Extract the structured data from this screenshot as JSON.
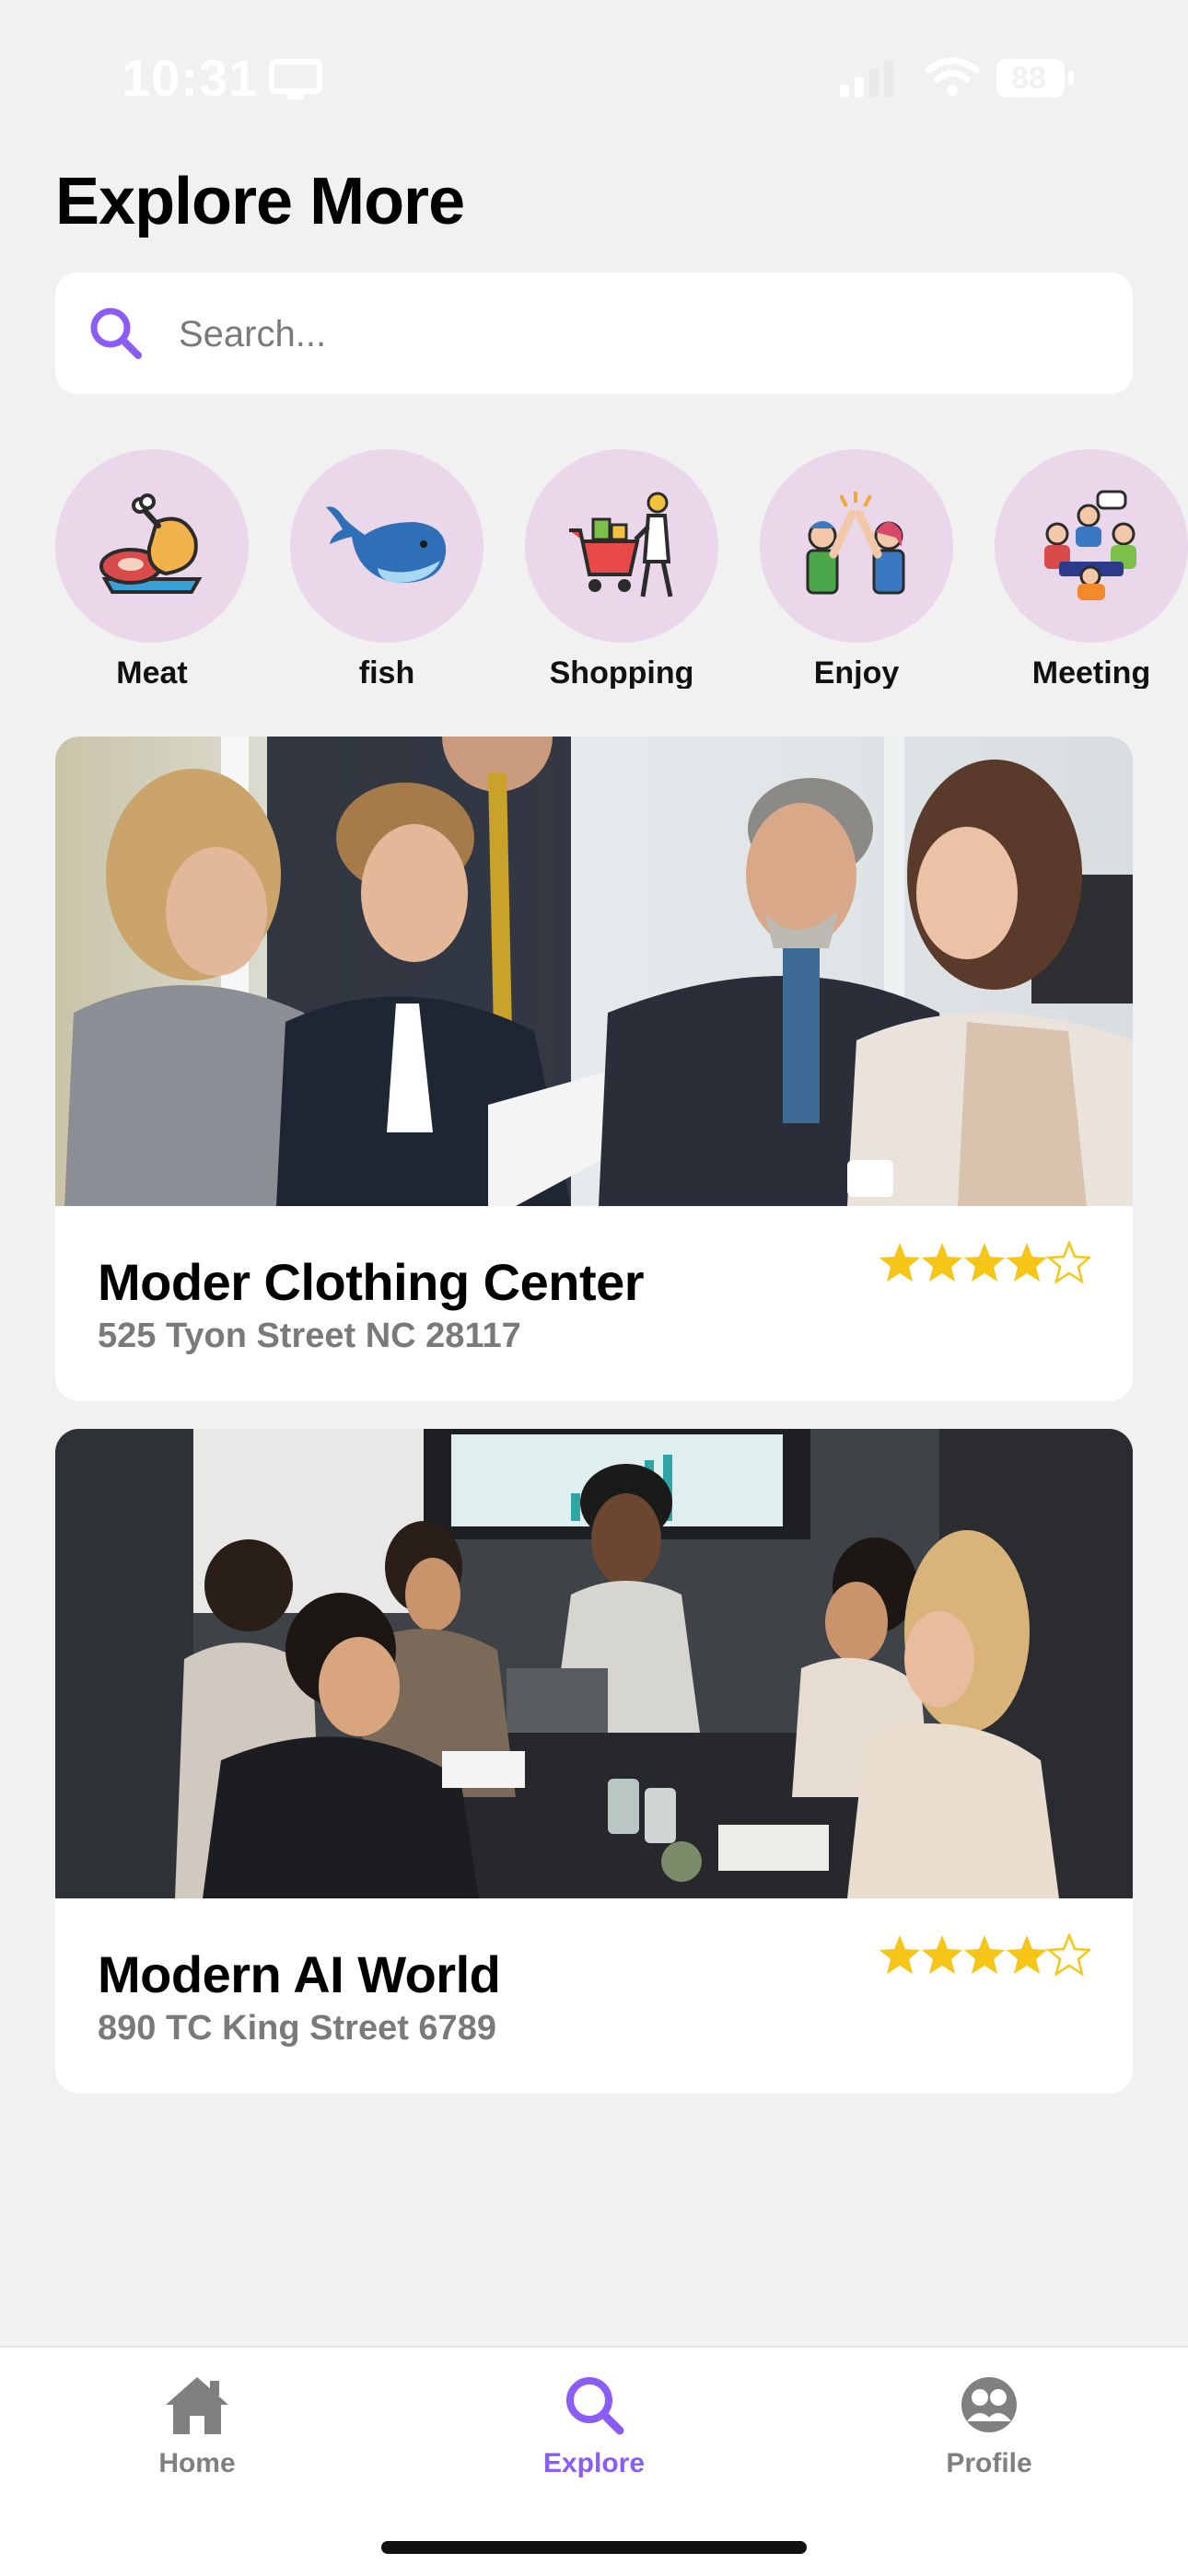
{
  "status_bar": {
    "time": "10:31",
    "battery": "88"
  },
  "page": {
    "title": "Explore More"
  },
  "search": {
    "placeholder": "Search..."
  },
  "categories": [
    {
      "label": "Meat",
      "icon": "meat-icon"
    },
    {
      "label": "fish",
      "icon": "whale-icon"
    },
    {
      "label": "Shopping",
      "icon": "shopping-cart-icon"
    },
    {
      "label": "Enjoy",
      "icon": "high-five-icon"
    },
    {
      "label": "Meeting",
      "icon": "meeting-icon"
    }
  ],
  "places": [
    {
      "title": "Moder Clothing Center",
      "address": "525 Tyon Street NC 28117",
      "rating": 4,
      "max_rating": 5
    },
    {
      "title": "Modern AI World",
      "address": "890 TC King Street 6789",
      "rating": 4.5,
      "max_rating": 5
    }
  ],
  "tab_bar": {
    "items": [
      {
        "label": "Home",
        "icon": "home-icon",
        "active": false
      },
      {
        "label": "Explore",
        "icon": "search-icon",
        "active": true
      },
      {
        "label": "Profile",
        "icon": "profile-icon",
        "active": false
      }
    ]
  },
  "colors": {
    "accent": "#8b5cf6",
    "inactive": "#808080",
    "star": "#f5c518",
    "category_bg": "#ead8ea",
    "background": "#f1f1f1"
  }
}
